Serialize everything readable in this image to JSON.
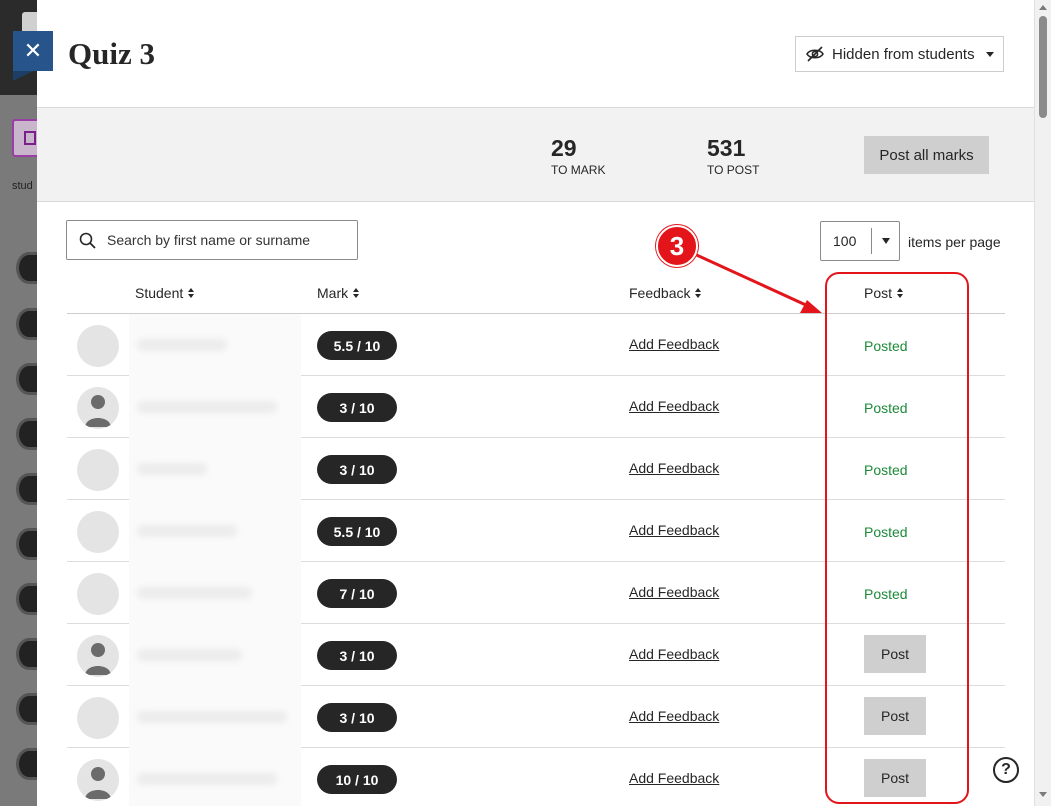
{
  "background_app": {
    "sidebar_label": "stud"
  },
  "panel": {
    "title": "Quiz 3",
    "visibility": {
      "label": "Hidden from students",
      "icon": "eye-slash-icon"
    },
    "stats": [
      {
        "value": "29",
        "label": "TO MARK"
      },
      {
        "value": "531",
        "label": "TO POST"
      }
    ],
    "post_all_label": "Post all marks",
    "search": {
      "placeholder": "Search by first name or surname"
    },
    "pagination": {
      "per_page": "100",
      "label": "items per page"
    },
    "table": {
      "headers": {
        "student": "Student",
        "mark": "Mark",
        "feedback": "Feedback",
        "post": "Post"
      },
      "rows": [
        {
          "avatar": "blank",
          "mark": "5.5  / 10",
          "feedback": "Add Feedback",
          "post_status": "Posted"
        },
        {
          "avatar": "person",
          "mark": "3  / 10",
          "feedback": "Add Feedback",
          "post_status": "Posted"
        },
        {
          "avatar": "blank",
          "mark": "3  / 10",
          "feedback": "Add Feedback",
          "post_status": "Posted"
        },
        {
          "avatar": "blank",
          "mark": "5.5  / 10",
          "feedback": "Add Feedback",
          "post_status": "Posted"
        },
        {
          "avatar": "blank",
          "mark": "7  / 10",
          "feedback": "Add Feedback",
          "post_status": "Posted"
        },
        {
          "avatar": "person",
          "mark": "3  / 10",
          "feedback": "Add Feedback",
          "post_status": "Post"
        },
        {
          "avatar": "blank",
          "mark": "3  / 10",
          "feedback": "Add Feedback",
          "post_status": "Post"
        },
        {
          "avatar": "person",
          "mark": "10  / 10",
          "feedback": "Add Feedback",
          "post_status": "Post"
        }
      ]
    }
  },
  "annotation": {
    "number": "3",
    "color": "#e3151a"
  },
  "colors": {
    "posted_green": "#1c8a3a",
    "close_tab_blue": "#27548a",
    "pill_dark": "#262626"
  }
}
